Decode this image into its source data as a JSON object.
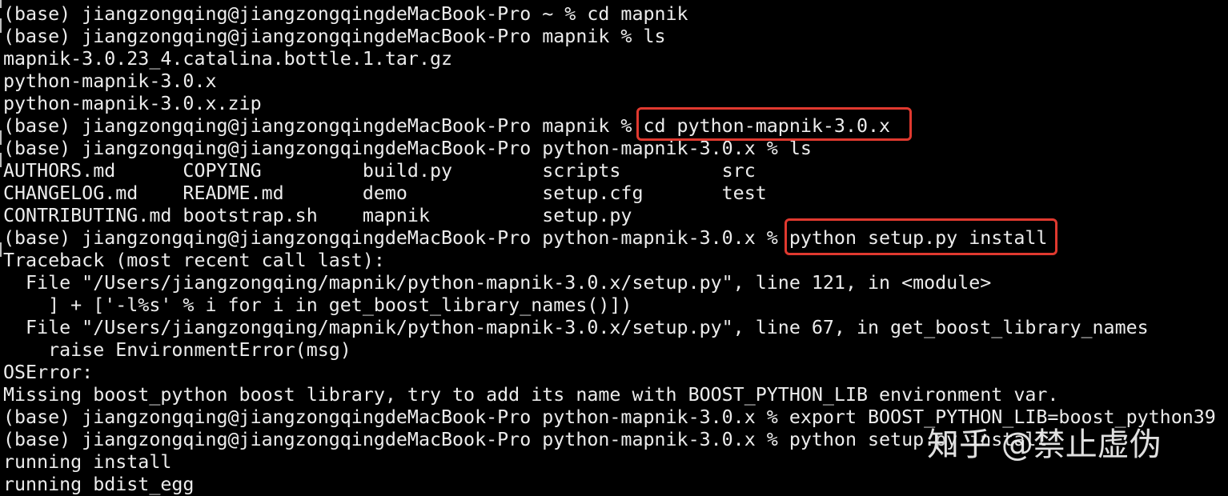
{
  "terminal": {
    "lines": [
      "(base) jiangzongqing@jiangzongqingdeMacBook-Pro ~ % cd mapnik",
      "(base) jiangzongqing@jiangzongqingdeMacBook-Pro mapnik % ls",
      "mapnik-3.0.23_4.catalina.bottle.1.tar.gz",
      "python-mapnik-3.0.x",
      "python-mapnik-3.0.x.zip",
      "(base) jiangzongqing@jiangzongqingdeMacBook-Pro mapnik % cd python-mapnik-3.0.x",
      "(base) jiangzongqing@jiangzongqingdeMacBook-Pro python-mapnik-3.0.x % ls",
      "AUTHORS.md      COPYING         build.py        scripts         src",
      "CHANGELOG.md    README.md       demo            setup.cfg       test",
      "CONTRIBUTING.md bootstrap.sh    mapnik          setup.py",
      "(base) jiangzongqing@jiangzongqingdeMacBook-Pro python-mapnik-3.0.x % python setup.py install",
      "Traceback (most recent call last):",
      "  File \"/Users/jiangzongqing/mapnik/python-mapnik-3.0.x/setup.py\", line 121, in <module>",
      "    ] + ['-l%s' % i for i in get_boost_library_names()])",
      "  File \"/Users/jiangzongqing/mapnik/python-mapnik-3.0.x/setup.py\", line 67, in get_boost_library_names",
      "    raise EnvironmentError(msg)",
      "OSError:",
      "Missing boost_python boost library, try to add its name with BOOST_PYTHON_LIB environment var.",
      "(base) jiangzongqing@jiangzongqingdeMacBook-Pro python-mapnik-3.0.x % export BOOST_PYTHON_LIB=boost_python39",
      "(base) jiangzongqing@jiangzongqingdeMacBook-Pro python-mapnik-3.0.x % python setup.py install",
      "running install",
      "running bdist_egg"
    ],
    "highlighted_commands": [
      "cd python-mapnik-3.0.x",
      "python setup.py install"
    ],
    "highlight_color": "#e0392f",
    "background_color": "#000000",
    "text_color": "#ececec"
  },
  "watermark": {
    "text": "知乎 @禁止虚伪"
  }
}
